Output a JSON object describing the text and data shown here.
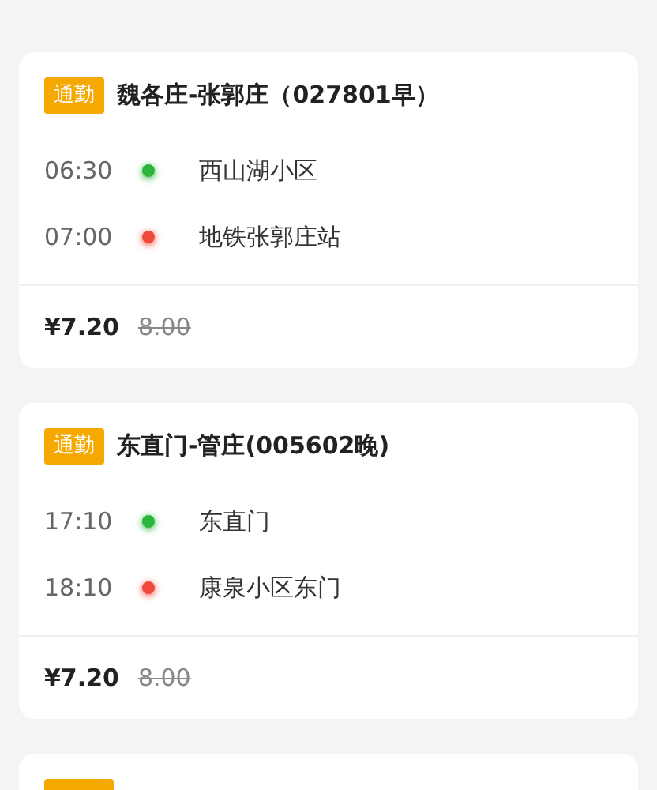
{
  "trips": [
    {
      "kind": "full",
      "tag": "通勤",
      "title": "魏各庄-张郭庄（027801早）",
      "stops": [
        {
          "time": "06:30",
          "name": "西山湖小区",
          "color": "#2bb53c"
        },
        {
          "time": "07:00",
          "name": "地铁张郭庄站",
          "color": "#f04a3a"
        }
      ],
      "price": "¥7.20",
      "original_price": "8.00"
    },
    {
      "kind": "full",
      "tag": "通勤",
      "title": "东直门-管庄(005602晚)",
      "stops": [
        {
          "time": "17:10",
          "name": "东直门",
          "color": "#2bb53c"
        },
        {
          "time": "18:10",
          "name": "康泉小区东门",
          "color": "#f04a3a"
        }
      ],
      "price": "¥7.20",
      "original_price": "8.00"
    },
    {
      "kind": "cut"
    }
  ]
}
